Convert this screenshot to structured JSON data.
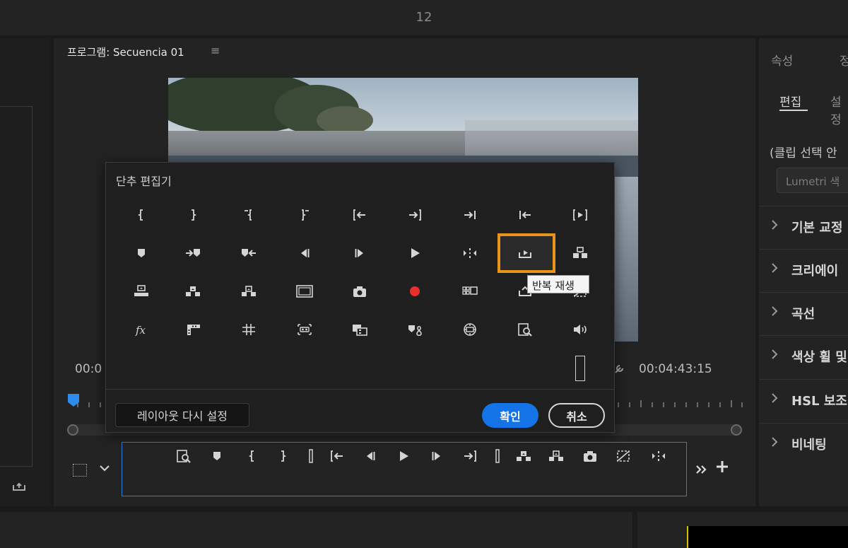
{
  "topbar": {
    "number": "12"
  },
  "program": {
    "title": "프로그램: Secuencia 01",
    "menu_icon": "≡",
    "timecode_left": "00:0",
    "timecode_right": "00:04:43:15"
  },
  "right_panel": {
    "tab1": "속성",
    "tab2": "정",
    "subtab_active": "편집",
    "subtab2": "설정",
    "clip_info": "(클립 선택 안",
    "lumetri_button": "Lumetri 색",
    "sections": [
      {
        "label": "기본 교정"
      },
      {
        "label": "크리에이"
      },
      {
        "label": "곡선"
      },
      {
        "label": "색상 휠 및"
      },
      {
        "label": "HSL 보조"
      },
      {
        "label": "비네팅"
      }
    ]
  },
  "dialog": {
    "title": "단추 편집기",
    "tooltip": "반복 재생",
    "reset_button": "레이아웃 다시 설정",
    "ok_button": "확인",
    "cancel_button": "취소",
    "grid_icons": [
      [
        "mark-in-icon",
        "mark-out-icon",
        "clear-in-icon",
        "clear-out-icon",
        "go-to-in-icon",
        "go-to-out-icon",
        "go-to-next-edit-icon",
        "go-to-prev-edit-icon",
        "play-in-to-out-icon"
      ],
      [
        "add-marker-icon",
        "go-to-next-marker-icon",
        "go-to-prev-marker-icon",
        "step-back-icon",
        "step-forward-icon",
        "play-icon",
        "trim-icon",
        "loop-playback-icon",
        "insert-icon"
      ],
      [
        "overwrite-icon",
        "lift-icon",
        "extract-icon",
        "safe-margins-icon",
        "export-frame-icon",
        "record-icon",
        "multi-camera-icon",
        "restore-icon",
        "comparison-icon"
      ],
      [
        "fx-icon",
        "proxy-icon",
        "grid-icon",
        "vr-icon",
        "overlay-icon",
        "lumetri-icon",
        "global-fx-icon",
        "find-icon",
        "volume-icon"
      ]
    ]
  },
  "transport": {
    "buttons": [
      "zoom-find-icon",
      "add-marker-icon",
      "mark-in-icon",
      "mark-out-icon",
      "separator-icon",
      "go-to-in-icon",
      "step-back-icon",
      "play-icon",
      "step-forward-icon",
      "go-to-out-icon",
      "separator-icon",
      "lift-icon",
      "extract-icon",
      "export-frame-icon",
      "comparison-icon",
      "trim-icon"
    ]
  },
  "colors": {
    "accent": "#1473e6",
    "highlight": "#e8931a",
    "record": "#e8302b",
    "playhead": "#2d8ceb"
  }
}
